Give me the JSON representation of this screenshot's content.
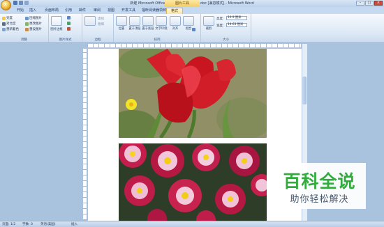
{
  "window": {
    "title": "新建 Microsoft Office Word 97-2003 文档.doc [兼容模式] - Microsoft Word",
    "context_tab": "图片工具"
  },
  "tabs": [
    "开始",
    "插入",
    "页面布局",
    "引用",
    "邮件",
    "审阅",
    "视图",
    "开发工具",
    "福昕阅读器领鲜版",
    "格式"
  ],
  "active_tab": "格式",
  "ribbon": {
    "adjust": {
      "label": "调整",
      "items": [
        "亮度",
        "对比度",
        "重新着色",
        "压缩图片",
        "更改图片",
        "重设图片"
      ]
    },
    "styles": {
      "label": "图片样式",
      "main": "图片边框"
    },
    "border_group": {
      "label": "边框",
      "items": [
        "边框",
        "虚线",
        "粗细"
      ]
    },
    "arrange": {
      "label": "排列",
      "items": [
        "位置",
        "置于顶层",
        "置于底层",
        "文字环绕",
        "对齐",
        "组合",
        "旋转"
      ]
    },
    "size": {
      "label": "大小",
      "crop": "裁剪",
      "height_label": "高度:",
      "height": "10.9 厘米",
      "width_label": "宽度:",
      "width": "14.63 厘米"
    }
  },
  "status": {
    "page": "页面: 1/2",
    "words": "字数: 0",
    "lang": "英语(美国)",
    "mode": "插入"
  },
  "watermark": {
    "title": "百科全说",
    "subtitle": "助你轻松解决"
  },
  "colors": {
    "accent": "#32ab3d",
    "ribbon": "#dce8f6",
    "context": "#f4cd63"
  }
}
